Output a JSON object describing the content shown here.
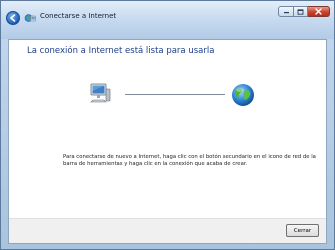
{
  "window": {
    "title": "Conectarse a Internet",
    "caption_buttons": [
      "minimize-icon",
      "maximize-icon",
      "close-icon"
    ]
  },
  "navigation": {
    "back_icon": "back-arrow-icon"
  },
  "main": {
    "heading": "La conexión a Internet está lista para usarla",
    "instructions": "Para conectarse de nuevo a Internet, haga clic con el botón secundario en el icono de red de la barra de herramientas y haga clic en la conexión que acaba de crear.",
    "icons": [
      "computer-icon",
      "globe-icon"
    ]
  },
  "footer": {
    "close_label": "Cerrar"
  },
  "colors": {
    "heading": "#1e3f88",
    "titlebar": "#c8dbf0",
    "close_button": "#c8442f"
  }
}
